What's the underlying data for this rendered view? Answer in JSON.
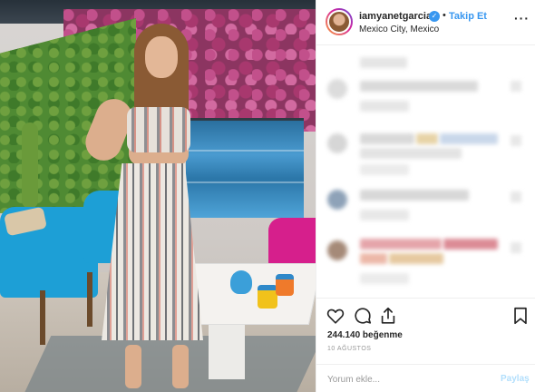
{
  "post": {
    "username": "iamyanetgarcia",
    "verified_mark": "✓",
    "separator": "•",
    "follow_label": "Takip Et",
    "location": "Mexico City, Mexico",
    "more_label": "···"
  },
  "engagement": {
    "likes": "244.140 beğenme",
    "date": "10 AĞUSTOS"
  },
  "comment_box": {
    "placeholder": "Yorum ekle...",
    "post_label": "Paylaş"
  },
  "icons": [
    "heart-icon",
    "comment-icon",
    "share-icon",
    "bookmark-icon"
  ],
  "colors": {
    "accent": "#3897f0",
    "post_disabled": "#b2dffc",
    "text": "#262626",
    "muted": "#999999"
  }
}
